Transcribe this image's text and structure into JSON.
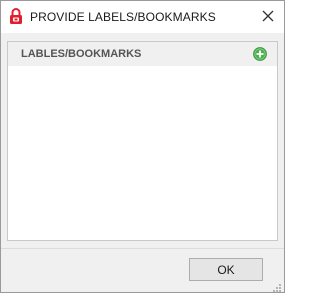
{
  "window": {
    "title": "PROVIDE LABELS/BOOKMARKS",
    "icon": "lock-icon",
    "close_icon": "close-icon"
  },
  "panel": {
    "title": "LABLES/BOOKMARKS",
    "add_icon": "add-circle-icon"
  },
  "footer": {
    "ok_label": "OK",
    "grip_icon": "resize-grip-icon"
  },
  "colors": {
    "lock_red": "#e0202f",
    "add_green": "#4caf50"
  }
}
